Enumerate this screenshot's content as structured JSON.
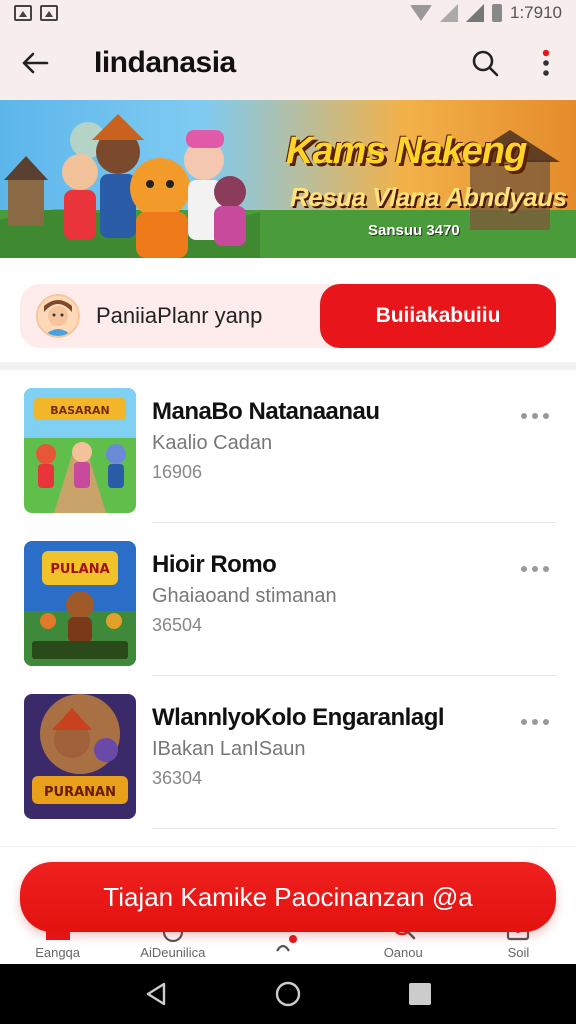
{
  "status": {
    "time": "1:7910"
  },
  "header": {
    "title": "Iindanasia"
  },
  "banner": {
    "title": "Kams Nakeng",
    "subtitle": "Resua Vlana Abndyaus",
    "tag": "Sansuu 3470"
  },
  "promo": {
    "text": "PaniiaPlanr yanp",
    "button": "Buiiakabuiiu"
  },
  "items": [
    {
      "title": "ManaBo Natanaanau",
      "subtitle": "Kaalio Cadan",
      "count": "16906",
      "thumb_text": "BASARAN"
    },
    {
      "title": "Hioir Romo",
      "subtitle": "Ghaiaoand stimanan",
      "count": "36504",
      "thumb_text": "PULANA"
    },
    {
      "title": "WlannlyoKolo Engaranlagl",
      "subtitle": "IBakan LanISaun",
      "count": "36304",
      "thumb_text": "PURANAN"
    }
  ],
  "cta": {
    "label": "Tiajan Kamike Paocinanzan @a"
  },
  "nav": [
    {
      "label": "Eangqa",
      "icon": "home-icon"
    },
    {
      "label": "AiDeunilica",
      "icon": "fire-icon"
    },
    {
      "label": "",
      "icon": "center-icon"
    },
    {
      "label": "Oanou",
      "icon": "search-person-icon"
    },
    {
      "label": "Soil",
      "icon": "bag-icon"
    }
  ],
  "colors": {
    "accent": "#e8161a",
    "bar_bg": "#f8eded"
  }
}
